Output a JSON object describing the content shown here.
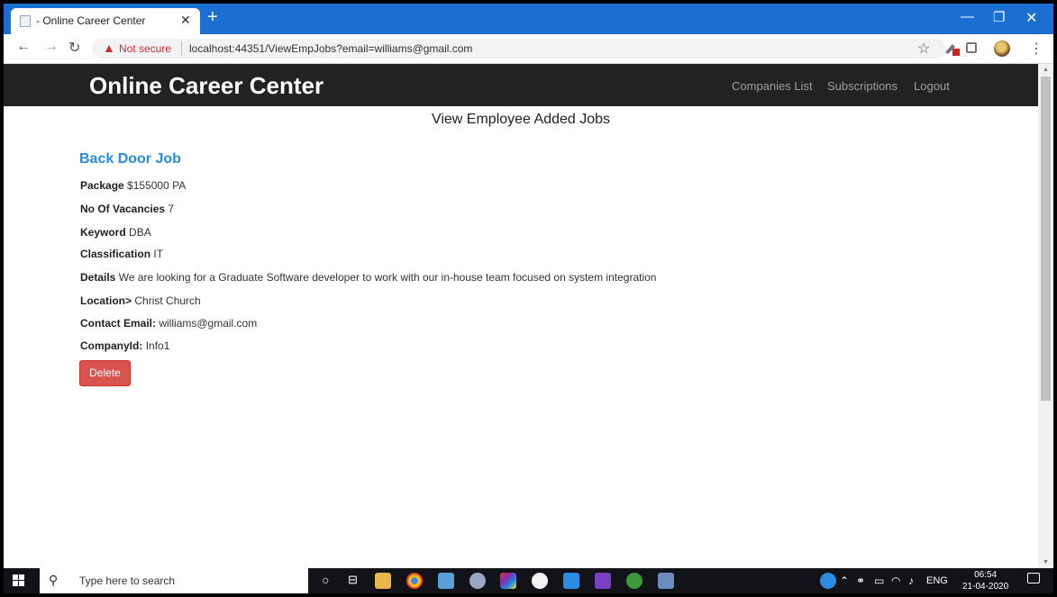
{
  "browser": {
    "tab_title": "- Online Career Center",
    "new_tab_symbol": "+",
    "not_secure": "Not secure",
    "url": "localhost:44351/ViewEmpJobs?email=williams@gmail.com"
  },
  "navbar": {
    "brand": "Online Career Center",
    "links": [
      "Companies List",
      "Subscriptions",
      "Logout"
    ]
  },
  "page": {
    "title": "View Employee Added Jobs",
    "job": {
      "title": "Back Door Job",
      "fields": [
        {
          "label": "Package",
          "value": "$155000 PA"
        },
        {
          "label": "No Of Vacancies",
          "value": "7"
        },
        {
          "label": "Keyword",
          "value": "DBA"
        },
        {
          "label": "Classification",
          "value": "IT"
        },
        {
          "label": "Details",
          "value": "We are looking for a Graduate Software developer to work with our in-house team focused on system integration"
        },
        {
          "label": "Location>",
          "value": "Christ Church"
        },
        {
          "label": "Contact Email:",
          "value": "williams@gmail.com"
        },
        {
          "label": "CompanyId:",
          "value": "Info1"
        }
      ]
    },
    "delete_label": "Delete"
  },
  "taskbar": {
    "search_placeholder": "Type here to search",
    "lang": "ENG",
    "time": "06:54",
    "date": "21-04-2020"
  },
  "colors": {
    "chrome_blue": "#1a6fd0",
    "navbar_bg": "#222222",
    "link_blue": "#2a8ce0",
    "delete_red": "#d9534f"
  }
}
